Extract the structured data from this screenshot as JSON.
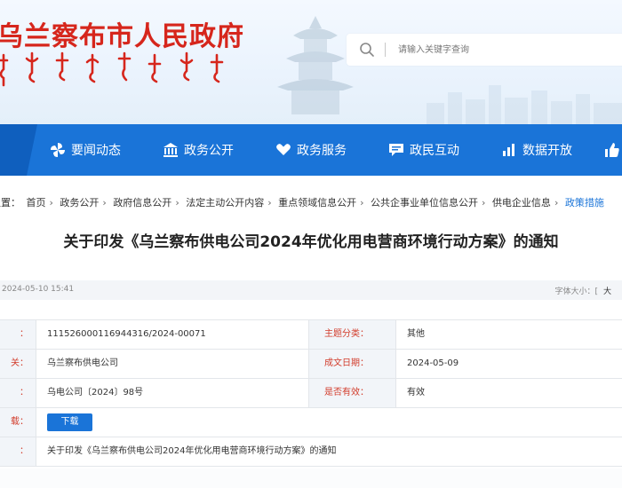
{
  "site": {
    "title": "乌兰察布市人民政府",
    "search_placeholder": "请输入关键字查询"
  },
  "nav": {
    "items": [
      {
        "label": "要闻动态",
        "icon": "pinwheel-icon"
      },
      {
        "label": "政务公开",
        "icon": "building-icon"
      },
      {
        "label": "政务服务",
        "icon": "heart-hands-icon"
      },
      {
        "label": "政民互动",
        "icon": "chat-icon"
      },
      {
        "label": "数据开放",
        "icon": "bar-chart-icon"
      }
    ]
  },
  "breadcrumb": {
    "prefix": "位置：",
    "items": [
      "首页",
      "政务公开",
      "政府信息公开",
      "法定主动公开内容",
      "重点领域信息公开",
      "公共企事业单位信息公开",
      "供电企业信息",
      "政策措施"
    ]
  },
  "article": {
    "title": "关于印发《乌兰察布供电公司2024年优化用电营商环境行动方案》的通知",
    "date": "2024-05-10 15:41",
    "font_size_label": "字体大小：[",
    "font_size_option": "大"
  },
  "info": {
    "rows": [
      {
        "label": "：",
        "value": "111526000116944316/2024-00071",
        "label2": "主题分类：",
        "value2": "其他"
      },
      {
        "label": "关：",
        "value": "乌兰察布供电公司",
        "label2": "成文日期：",
        "value2": "2024-05-09"
      },
      {
        "label": "：",
        "value": "乌电公司〔2024〕98号",
        "label2": "是否有效：",
        "value2": "有效"
      }
    ],
    "attachment_label": "载：",
    "download_label": "下载",
    "name_label": "：",
    "name_value": "关于印发《乌兰察布供电公司2024年优化用电营商环境行动方案》的通知"
  },
  "colors": {
    "brand_blue": "#1a74d8",
    "title_red": "#d6261c",
    "label_red": "#d23c2b"
  }
}
